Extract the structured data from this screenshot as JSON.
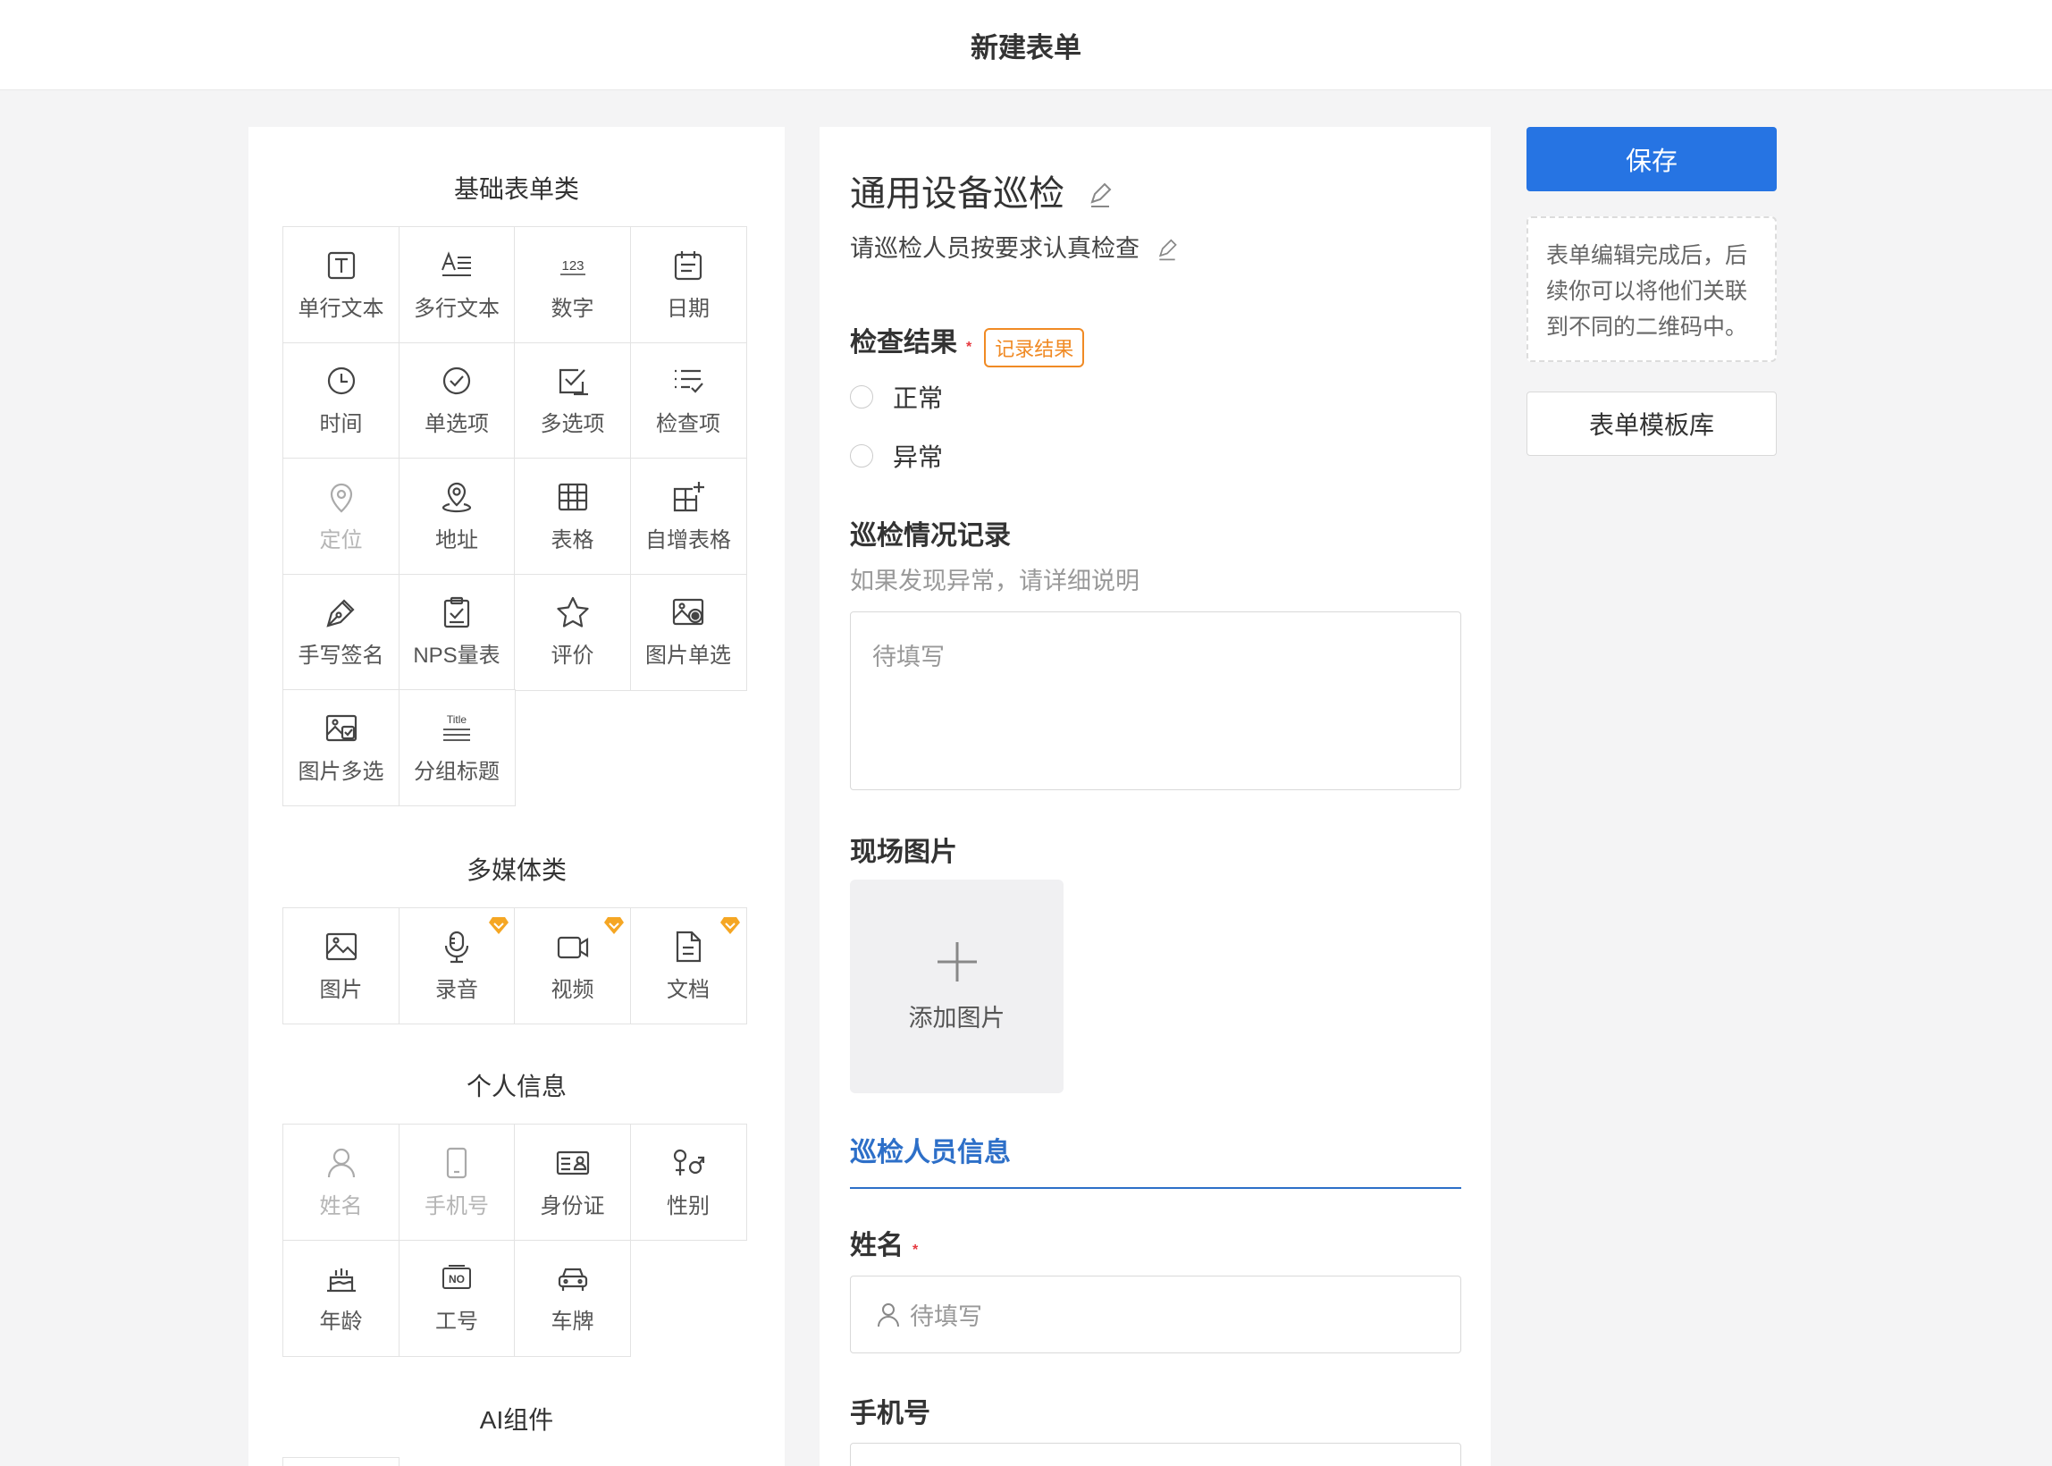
{
  "header": {
    "title": "新建表单"
  },
  "palette": {
    "basic": {
      "title": "基础表单类",
      "items": [
        {
          "label": "单行文本",
          "icon": "text-box-icon"
        },
        {
          "label": "多行文本",
          "icon": "multiline-text-icon"
        },
        {
          "label": "数字",
          "icon": "number-icon"
        },
        {
          "label": "日期",
          "icon": "calendar-icon"
        },
        {
          "label": "时间",
          "icon": "clock-icon"
        },
        {
          "label": "单选项",
          "icon": "check-circle-icon"
        },
        {
          "label": "多选项",
          "icon": "checkbox-icon"
        },
        {
          "label": "检查项",
          "icon": "checklist-icon"
        },
        {
          "label": "定位",
          "icon": "location-pin-icon"
        },
        {
          "label": "地址",
          "icon": "address-pin-icon"
        },
        {
          "label": "表格",
          "icon": "table-icon"
        },
        {
          "label": "自增表格",
          "icon": "table-add-icon"
        },
        {
          "label": "手写签名",
          "icon": "pen-nib-icon"
        },
        {
          "label": "NPS量表",
          "icon": "clipboard-check-icon"
        },
        {
          "label": "评价",
          "icon": "star-icon"
        },
        {
          "label": "图片单选",
          "icon": "image-radio-icon"
        },
        {
          "label": "图片多选",
          "icon": "image-check-icon"
        },
        {
          "label": "分组标题",
          "icon": "title-lines-icon",
          "icon_text": "Title"
        }
      ]
    },
    "media": {
      "title": "多媒体类",
      "items": [
        {
          "label": "图片",
          "icon": "image-icon"
        },
        {
          "label": "录音",
          "icon": "microphone-icon"
        },
        {
          "label": "视频",
          "icon": "video-camera-icon"
        },
        {
          "label": "文档",
          "icon": "document-icon"
        }
      ]
    },
    "personal": {
      "title": "个人信息",
      "items": [
        {
          "label": "姓名",
          "icon": "user-icon"
        },
        {
          "label": "手机号",
          "icon": "phone-icon"
        },
        {
          "label": "身份证",
          "icon": "id-card-icon"
        },
        {
          "label": "性别",
          "icon": "gender-icon"
        },
        {
          "label": "年龄",
          "icon": "birthday-cake-icon"
        },
        {
          "label": "工号",
          "icon": "employee-no-icon",
          "icon_text": "NO"
        },
        {
          "label": "车牌",
          "icon": "car-icon"
        }
      ]
    },
    "ai": {
      "title": "AI组件"
    },
    "number_icon_text": "123"
  },
  "form": {
    "title": "通用设备巡检",
    "description": "请巡检人员按要求认真检查",
    "q1": {
      "label": "检查结果",
      "required": "*",
      "tag": "记录结果",
      "options": [
        "正常",
        "异常"
      ]
    },
    "q2": {
      "label": "巡检情况记录",
      "hint": "如果发现异常，请详细说明",
      "placeholder": "待填写"
    },
    "q3": {
      "label": "现场图片",
      "upload_label": "添加图片"
    },
    "section": "巡检人员信息",
    "q4": {
      "label": "姓名",
      "required": "*",
      "placeholder": "待填写"
    },
    "q5": {
      "label": "手机号"
    }
  },
  "actions": {
    "save": "保存",
    "note": "表单编辑完成后，后续你可以将他们关联到不同的二维码中。",
    "templates": "表单模板库"
  },
  "colors": {
    "primary": "#2674e3",
    "section_blue": "#2d6fc8",
    "tag_orange": "#f08a24",
    "required_red": "#e6393f",
    "vip_gold": "#f5a623"
  }
}
